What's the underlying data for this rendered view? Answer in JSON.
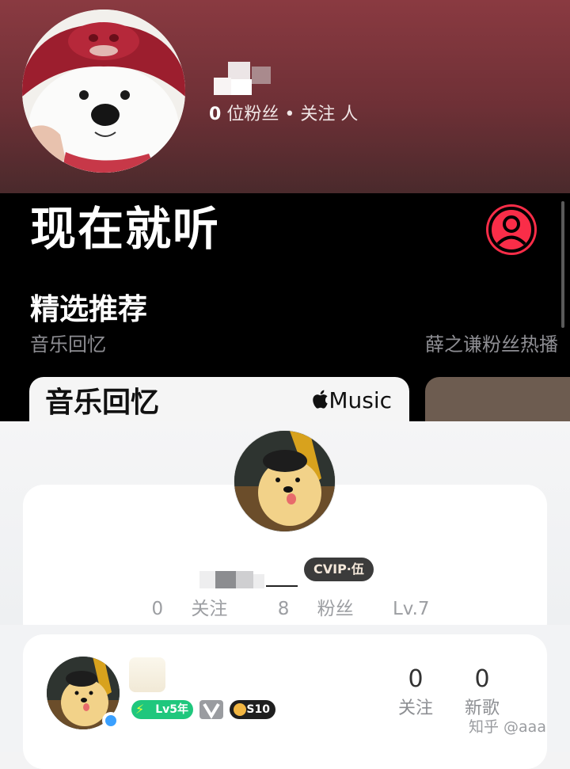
{
  "top_profile": {
    "stats": {
      "count": "0",
      "fans_label": "位粉丝",
      "dot": "•",
      "follow_label": "关注",
      "follow_suffix": "人"
    }
  },
  "music": {
    "title": "现在就听",
    "section_title": "精选推荐",
    "items": [
      {
        "subtitle": "音乐回忆"
      },
      {
        "subtitle": "薛之谦粉丝热播"
      }
    ],
    "card": {
      "title": "音乐回忆",
      "brand": "Music",
      "brand_icon": "apple-logo-icon"
    },
    "accent": "#fa2d48"
  },
  "profile_card": {
    "vip_badge": "CVIP·伍",
    "stats": [
      {
        "value": "0",
        "label": "关注"
      },
      {
        "value": "8",
        "label": "粉丝"
      },
      {
        "value": "Lv.7",
        "label": ""
      }
    ]
  },
  "mini_card": {
    "level_badge": "Lv5年",
    "s_badge": "S10",
    "stats": [
      {
        "value": "0",
        "label": "关注"
      },
      {
        "value": "0",
        "label": "新歌"
      }
    ],
    "watermark": "知乎 @aaa",
    "level_color": "#1fc77d"
  }
}
